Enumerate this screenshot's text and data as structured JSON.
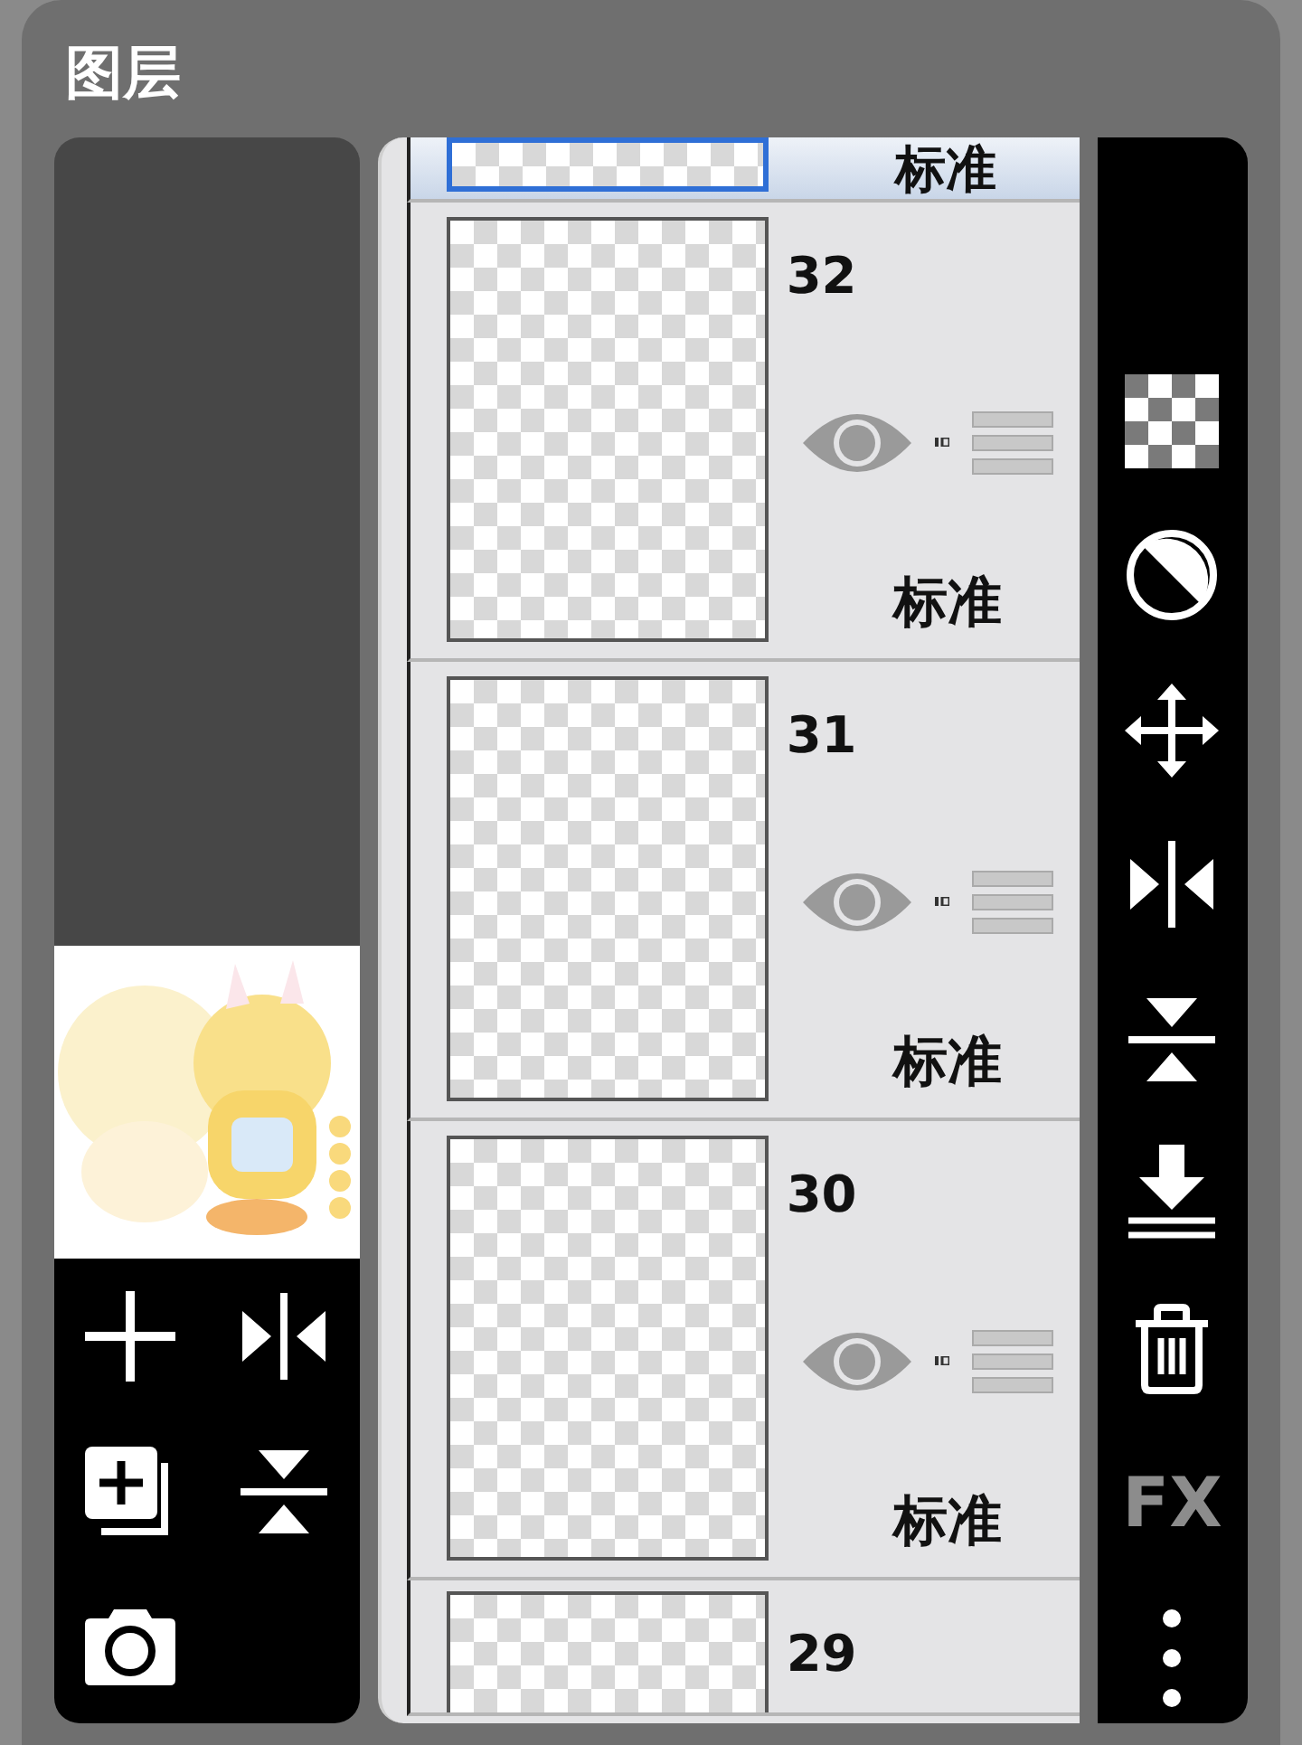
{
  "panel": {
    "title": "图层"
  },
  "layers": [
    {
      "kind": "top",
      "blend": "标准",
      "selected": true
    },
    {
      "kind": "full",
      "number": "32",
      "blend": "标准",
      "selected": false,
      "visible": true
    },
    {
      "kind": "full",
      "number": "31",
      "blend": "标准",
      "selected": false,
      "visible": true
    },
    {
      "kind": "full",
      "number": "30",
      "blend": "标准",
      "selected": false,
      "visible": true
    },
    {
      "kind": "bottom",
      "number": "29",
      "selected": false
    }
  ],
  "left_tools": [
    {
      "kind": "add"
    },
    {
      "kind": "flip-h"
    },
    {
      "kind": "duplicate"
    },
    {
      "kind": "flip-v"
    },
    {
      "kind": "camera"
    }
  ],
  "right_tools": [
    {
      "kind": "checker"
    },
    {
      "kind": "contrast"
    },
    {
      "kind": "move"
    },
    {
      "kind": "flip-h"
    },
    {
      "kind": "flip-v"
    },
    {
      "kind": "merge-down"
    },
    {
      "kind": "trash"
    },
    {
      "kind": "text",
      "label": "FX"
    },
    {
      "kind": "more"
    }
  ]
}
